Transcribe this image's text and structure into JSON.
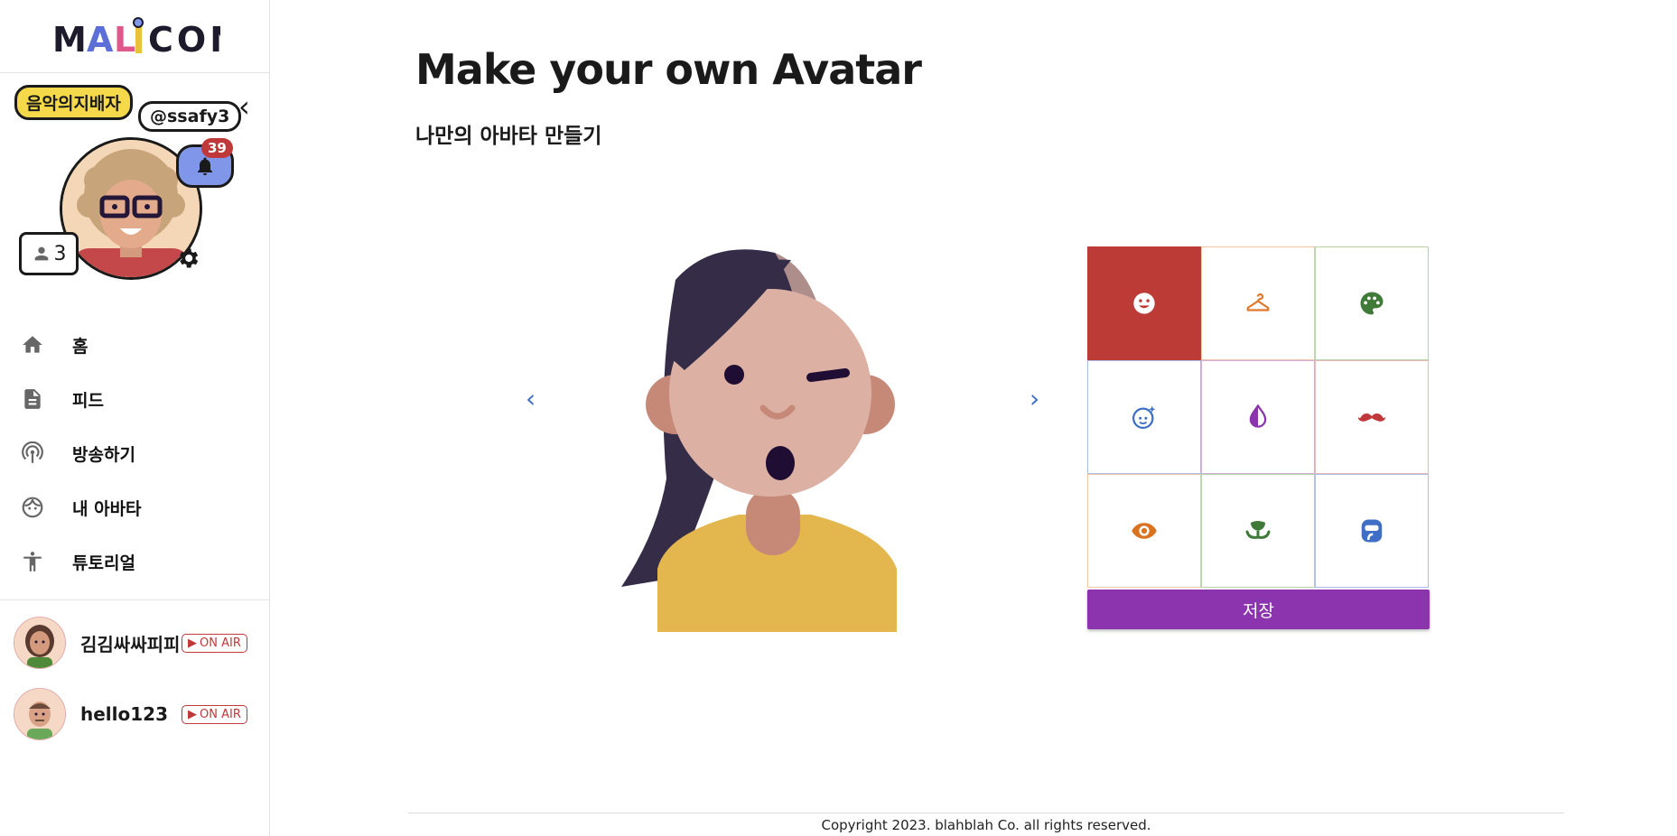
{
  "brand": {
    "logo_text": "MALICON",
    "accent": "#bd3b36",
    "save_color": "#8b34ad"
  },
  "profile": {
    "title_badge": "음악의지배자",
    "handle": "@ssafy3",
    "notification_count": "39",
    "follower_count": "3",
    "bell_icon": "bell-icon",
    "settings_icon": "gear-icon"
  },
  "nav": {
    "items": [
      {
        "label": "홈",
        "icon": "home-icon"
      },
      {
        "label": "피드",
        "icon": "feed-icon"
      },
      {
        "label": "방송하기",
        "icon": "broadcast-icon"
      },
      {
        "label": "내 아바타",
        "icon": "face-icon"
      },
      {
        "label": "튜토리얼",
        "icon": "accessibility-icon"
      }
    ]
  },
  "live_users": [
    {
      "name": "김김싸싸피피",
      "badge": "ON AIR"
    },
    {
      "name": "hello123",
      "badge": "ON AIR"
    }
  ],
  "main": {
    "title": "Make your own Avatar",
    "subtitle": "나만의 아바타 만들기",
    "prev_icon": "chevron-left-icon",
    "next_icon": "chevron-right-icon",
    "save_label": "저장"
  },
  "options": [
    {
      "icon": "face-smile-icon",
      "color": "#ffffff",
      "active": true
    },
    {
      "icon": "hanger-icon",
      "color": "#e0782e",
      "active": false
    },
    {
      "icon": "palette-icon",
      "color": "#3f7a39",
      "active": false
    },
    {
      "icon": "face-sparkle-icon",
      "color": "#3e6ec6",
      "active": false
    },
    {
      "icon": "contrast-drop-icon",
      "color": "#8b34ad",
      "active": false
    },
    {
      "icon": "mustache-icon",
      "color": "#c0393a",
      "active": false
    },
    {
      "icon": "eye-icon",
      "color": "#d9731f",
      "active": false
    },
    {
      "icon": "mouth-icon",
      "color": "#3f7a39",
      "active": false
    },
    {
      "icon": "mask-icon",
      "color": "#3e6ec6",
      "active": false
    }
  ],
  "footer": {
    "copyright": "Copyright 2023. blahblah Co. all rights reserved."
  }
}
